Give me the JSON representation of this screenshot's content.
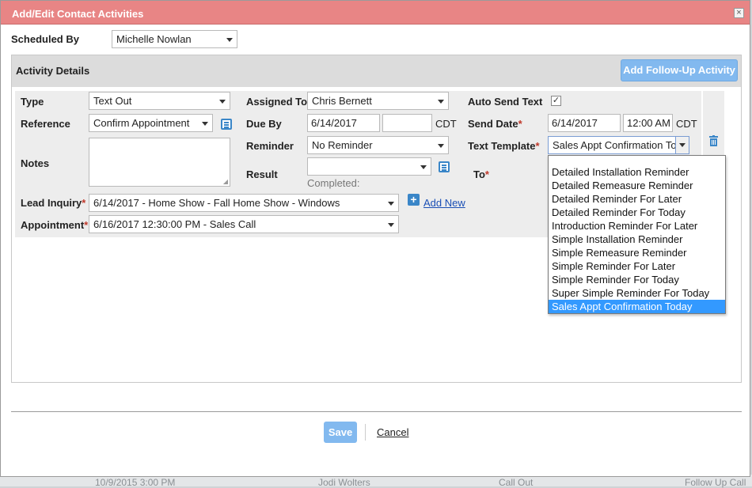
{
  "dialog": {
    "title": "Add/Edit Contact Activities",
    "close": "×"
  },
  "scheduled_by": {
    "label": "Scheduled By",
    "value": "Michelle Nowlan"
  },
  "activity_details": {
    "title": "Activity Details",
    "follow_up_button": "Add Follow-Up Activity"
  },
  "type": {
    "label": "Type",
    "value": "Text Out"
  },
  "reference": {
    "label": "Reference",
    "value": "Confirm Appointment"
  },
  "notes": {
    "label": "Notes",
    "value": ""
  },
  "assigned_to": {
    "label": "Assigned To",
    "value": "Chris Bernett"
  },
  "due_by": {
    "label": "Due By",
    "date": "6/14/2017",
    "time": "",
    "tz": "CDT"
  },
  "reminder": {
    "label": "Reminder",
    "value": "No Reminder"
  },
  "result": {
    "label": "Result",
    "value": "",
    "completed_label": "Completed:"
  },
  "auto_send_text": {
    "label": "Auto Send Text",
    "checked": "✓"
  },
  "send_date": {
    "label": "Send Date",
    "date": "6/14/2017",
    "time": "12:00 AM",
    "tz": "CDT"
  },
  "text_template": {
    "label": "Text Template",
    "value": "Sales Appt Confirmation Today",
    "options": [
      "Detailed Installation Reminder",
      "Detailed Remeasure Reminder",
      "Detailed Reminder For Later",
      "Detailed Reminder For Today",
      "Introduction Reminder For Later",
      "Simple Installation Reminder",
      "Simple Remeasure Reminder",
      "Simple Reminder For Later",
      "Simple Reminder For Today",
      "Super Simple Reminder For Today",
      "Sales Appt Confirmation Today"
    ],
    "selected_index": 10
  },
  "to": {
    "label": "To"
  },
  "lead_inquiry": {
    "label": "Lead Inquiry",
    "value": "6/14/2017 - Home Show - Fall Home Show - Windows",
    "add_new": "Add New"
  },
  "appointment": {
    "label": "Appointment",
    "value": "6/16/2017 12:30:00 PM - Sales Call"
  },
  "footer": {
    "save": "Save",
    "cancel": "Cancel"
  },
  "background_row": {
    "date": "10/9/2015 3:00 PM",
    "name": "Jodi Wolters",
    "type": "Call Out",
    "status": "Follow Up Call"
  },
  "colors": {
    "titlebar": "#e88585",
    "accent": "#82b9ef",
    "link": "#1a4fb5",
    "selected": "#3399ff"
  }
}
